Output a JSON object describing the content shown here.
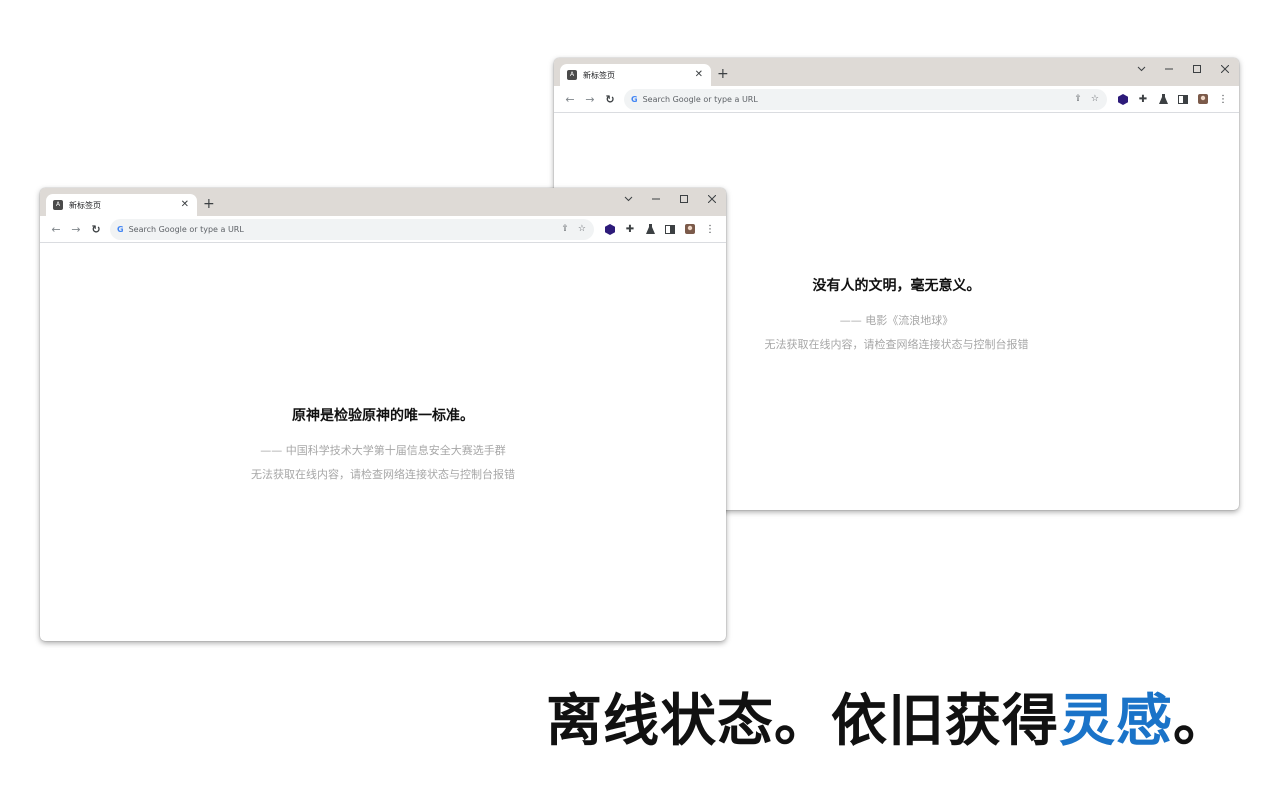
{
  "browser": {
    "tab_title": "新标签页",
    "favicon_letter": "A",
    "new_tab_symbol": "+",
    "omnibox_placeholder": "Search Google or type a URL",
    "icons": {
      "back": "arrow-left-icon",
      "forward": "arrow-right-icon",
      "reload": "reload-icon",
      "share": "share-icon",
      "bookmark": "star-icon",
      "extensions": [
        "hexagon-extension-icon",
        "puzzle-icon",
        "flask-icon",
        "side-panel-icon",
        "avatar-icon",
        "kebab-menu-icon"
      ]
    }
  },
  "windows": [
    {
      "quote": "原神是检验原神的唯一标准。",
      "source": "—— 中国科学技术大学第十届信息安全大赛选手群",
      "status": "无法获取在线内容，请检查网络连接状态与控制台报错"
    },
    {
      "quote": "没有人的文明，毫无意义。",
      "source": "—— 电影《流浪地球》",
      "status": "无法获取在线内容，请检查网络连接状态与控制台报错"
    }
  ],
  "tagline": {
    "main": "离线状态。依旧获得",
    "accent": "灵感",
    "end": "。"
  },
  "colors": {
    "accent": "#1a73c8",
    "tabstrip": "#dedad6",
    "muted_text": "#a7a7a7"
  }
}
